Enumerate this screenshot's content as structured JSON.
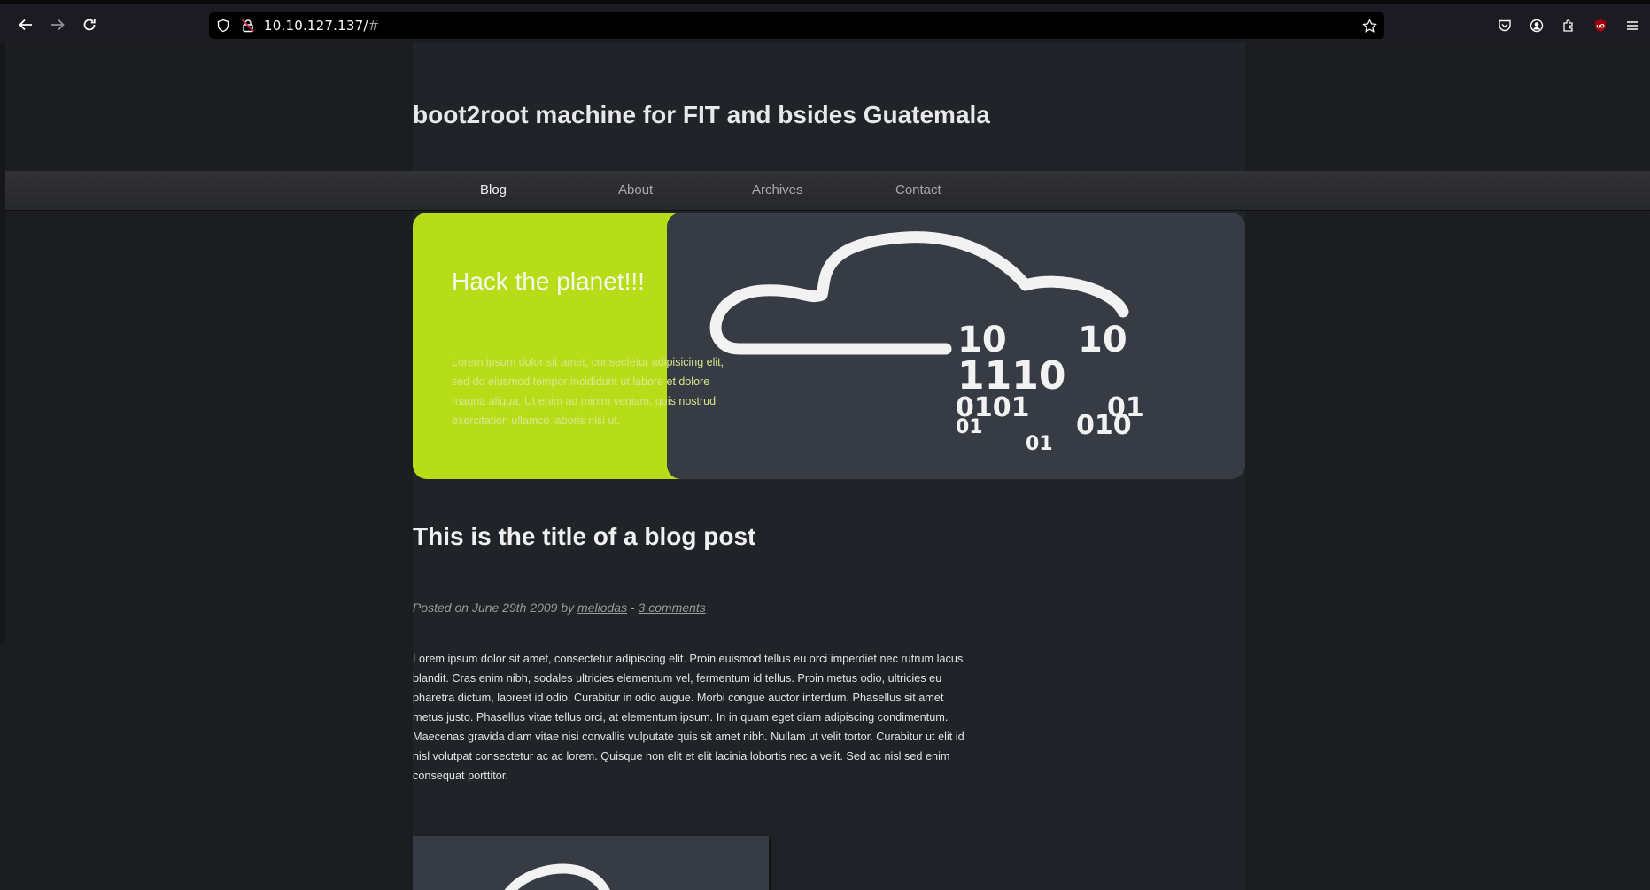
{
  "browser": {
    "url_host": "10.10.127.137/",
    "url_hash": "#"
  },
  "icons": {
    "back": "arrow-left-icon",
    "forward": "arrow-right-icon",
    "reload": "reload-icon",
    "site_info": "shield-icon",
    "connection": "lock-icon",
    "bookmark": "star-icon",
    "pocket": "pocket-icon",
    "account": "account-icon",
    "extensions": "puzzle-icon",
    "ublock": "ublock-icon",
    "menu": "hamburger-menu-icon"
  },
  "site": {
    "title": "boot2root machine for FIT and bsides Guatemala"
  },
  "nav": {
    "items": [
      "Blog",
      "About",
      "Archives",
      "Contact"
    ],
    "active": "Blog"
  },
  "hero": {
    "heading": "Hack the planet!!!",
    "text": "Lorem ipsum dolor sit amet, consectetur adipisicing elit, sed do eiusmod tempor incididunt ut labore et dolore magna aliqua. Ut enim ad minim veniam, quis nostrud exercitation ullamco laboris nisi ut.",
    "binary_lines": [
      "10",
      "10",
      "1110",
      "0101",
      "01",
      "01",
      "010",
      "01"
    ]
  },
  "post": {
    "title": "This is the title of a blog post",
    "meta_prefix": "Posted on June 29th 2009 by ",
    "author": "meliodas",
    "meta_sep": " - ",
    "comments": "3 comments",
    "body": "Lorem ipsum dolor sit amet, consectetur adipiscing elit. Proin euismod tellus eu orci imperdiet nec rutrum lacus blandit. Cras enim nibh, sodales ultricies elementum vel, fermentum id tellus. Proin metus odio, ultricies eu pharetra dictum, laoreet id odio. Curabitur in odio augue. Morbi congue auctor interdum. Phasellus sit amet metus justo. Phasellus vitae tellus orci, at elementum ipsum. In in quam eget diam adipiscing condimentum. Maecenas gravida diam vitae nisi convallis vulputate quis sit amet nibh. Nullam ut velit tortor. Curabitur ut elit id nisl volutpat consectetur ac ac lorem. Quisque non elit et elit lacinia lobortis nec a velit. Sed ac nisl sed enim consequat porttitor."
  },
  "colors": {
    "accent_green": "#b6dd18",
    "hero_dark": "#373c44",
    "page_bg": "#1b1d20",
    "column_bg": "#202327",
    "ublock_red": "#a1000d"
  }
}
